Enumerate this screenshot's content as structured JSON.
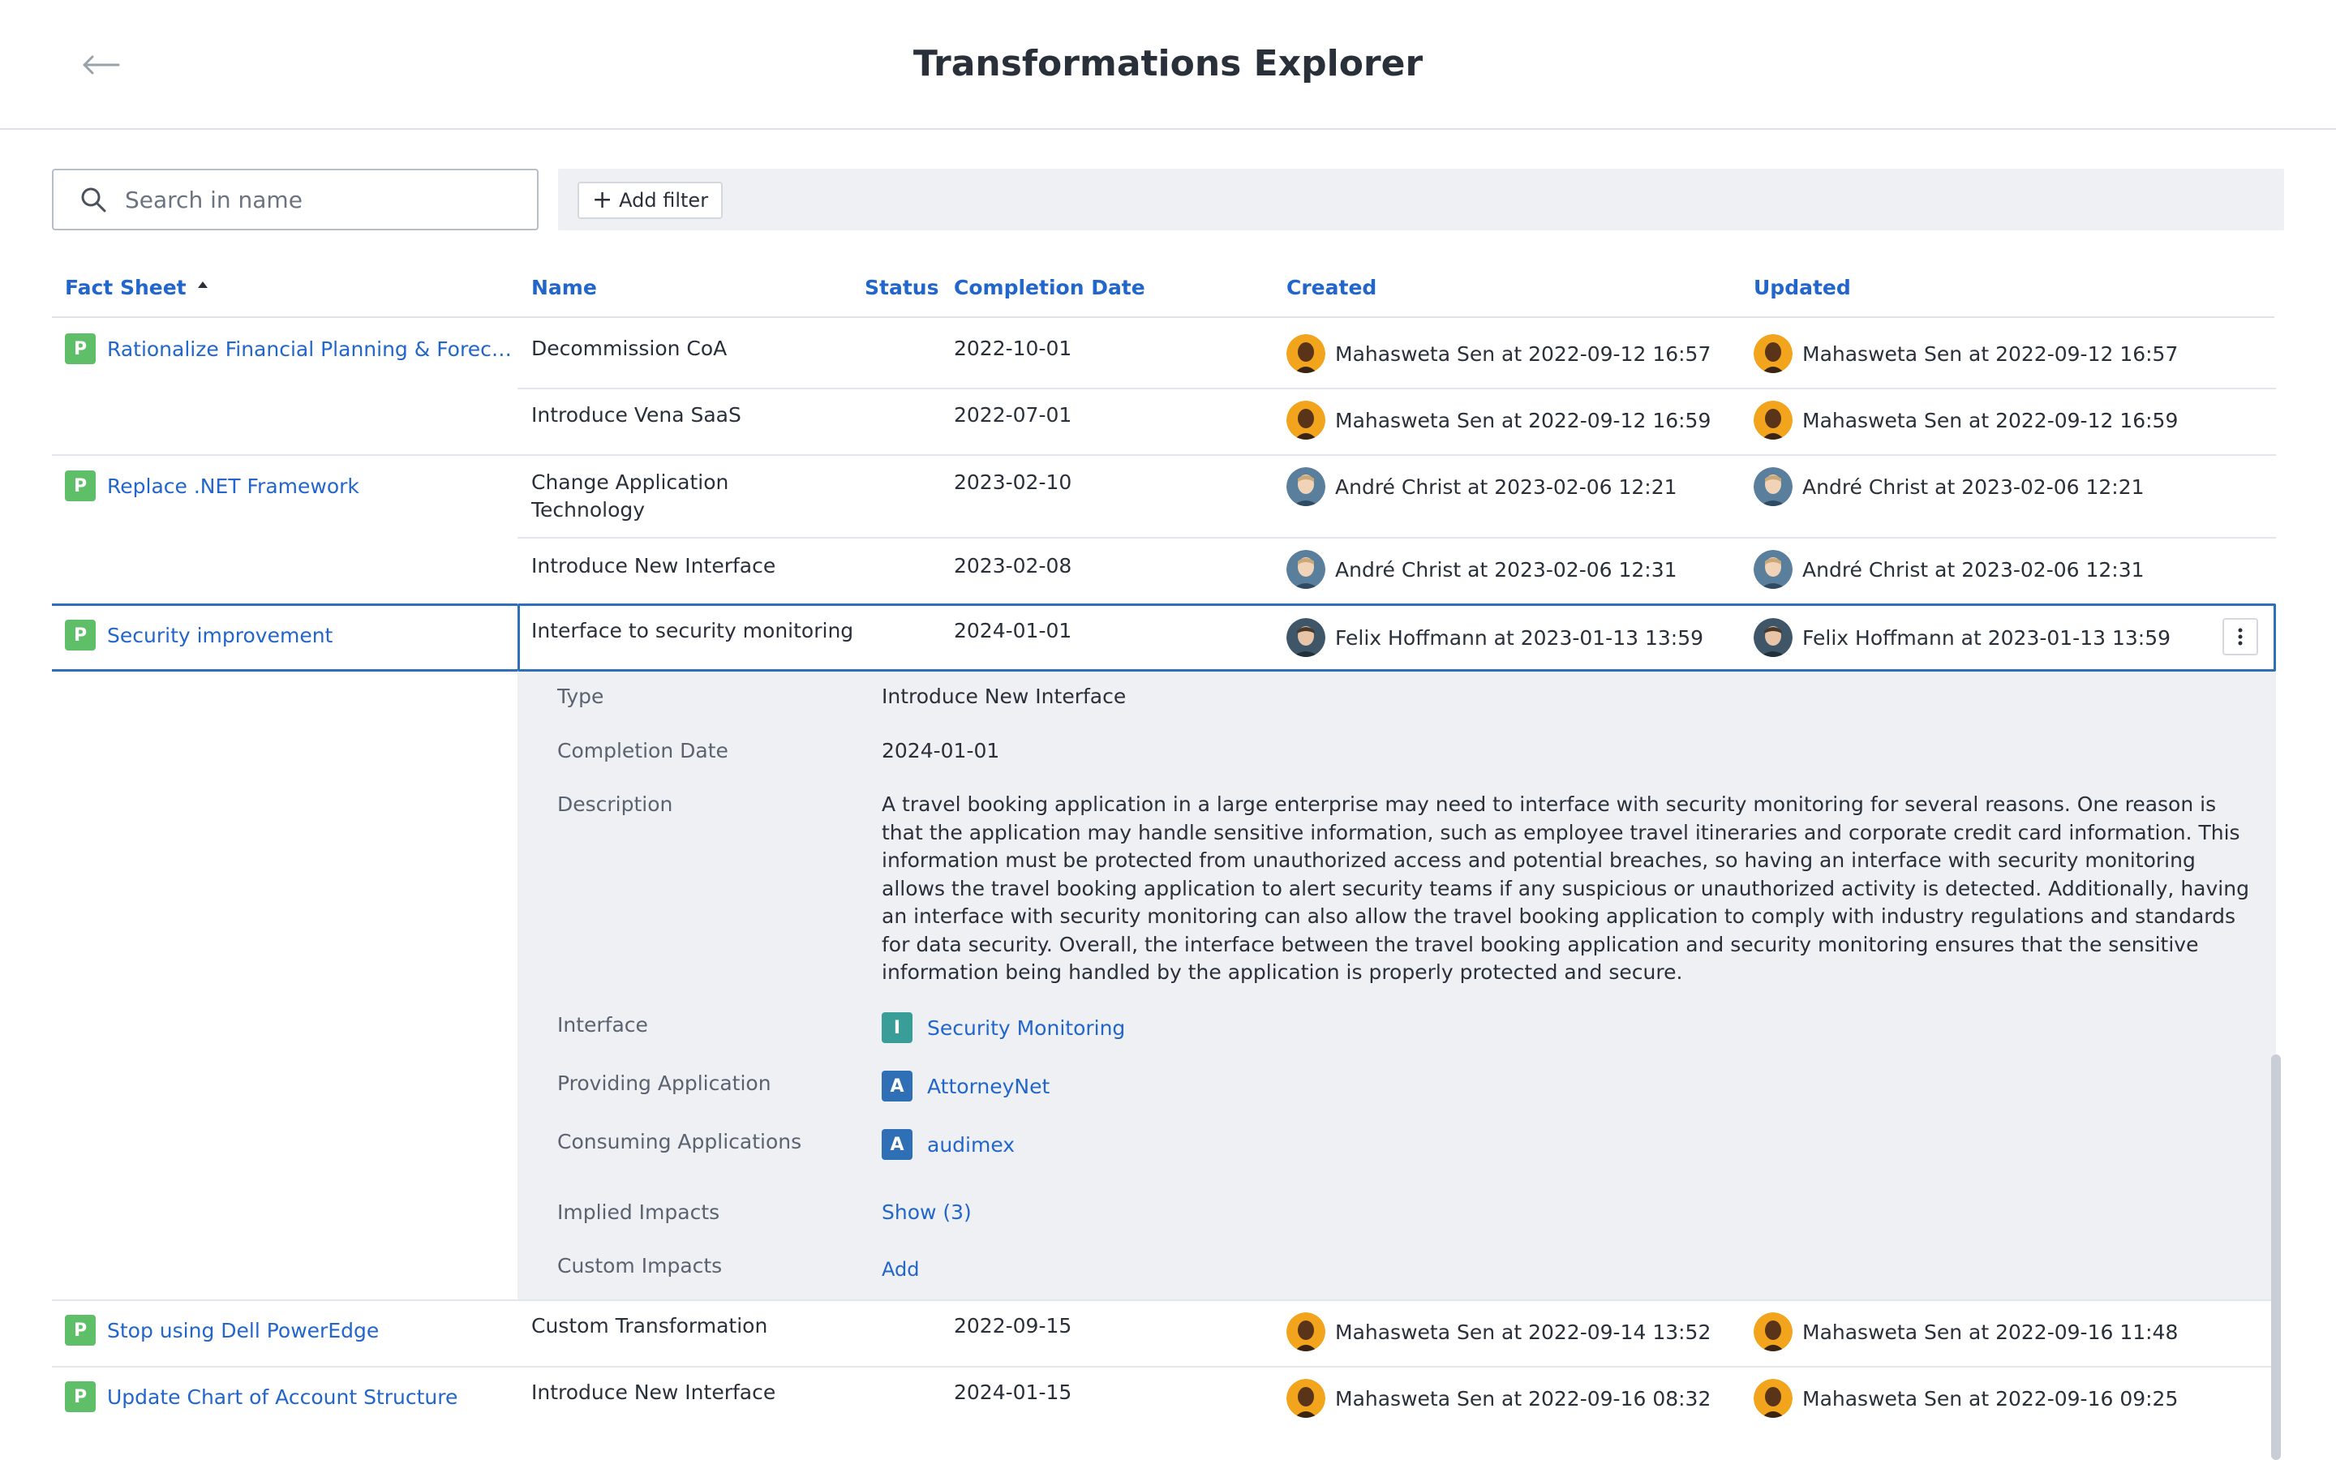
{
  "header": {
    "title": "Transformations Explorer"
  },
  "search": {
    "placeholder": "Search in name"
  },
  "filter": {
    "add_label": "Add filter"
  },
  "columns": {
    "fact_sheet": "Fact Sheet",
    "name": "Name",
    "status": "Status",
    "completion_date": "Completion Date",
    "created": "Created",
    "updated": "Updated"
  },
  "rows": [
    {
      "fact_sheet": "Rationalize Financial Planning & Forecas...",
      "badge": "P",
      "name": "Decommission CoA",
      "completion": "2022-10-01",
      "created": "Mahasweta Sen at 2022-09-12 16:57",
      "updated": "Mahasweta Sen at 2022-09-12 16:57"
    },
    {
      "fact_sheet": "",
      "name": "Introduce Vena SaaS",
      "completion": "2022-07-01",
      "created": "Mahasweta Sen at 2022-09-12 16:59",
      "updated": "Mahasweta Sen at 2022-09-12 16:59"
    },
    {
      "fact_sheet": "Replace .NET Framework",
      "badge": "P",
      "name": "Change Application Technology",
      "completion": "2023-02-10",
      "created": "André Christ at 2023-02-06 12:21",
      "updated": "André Christ at 2023-02-06 12:21"
    },
    {
      "fact_sheet": "",
      "name": "Introduce New Interface",
      "completion": "2023-02-08",
      "created": "André Christ at 2023-02-06 12:31",
      "updated": "André Christ at 2023-02-06 12:31"
    },
    {
      "fact_sheet": "Security improvement",
      "badge": "P",
      "name": "Interface to security monitoring",
      "completion": "2024-01-01",
      "created": "Felix Hoffmann at 2023-01-13 13:59",
      "updated": "Felix Hoffmann at 2023-01-13 13:59"
    },
    {
      "fact_sheet": "Stop using Dell PowerEdge",
      "badge": "P",
      "name": "Custom Transformation",
      "completion": "2022-09-15",
      "created": "Mahasweta Sen at 2022-09-14 13:52",
      "updated": "Mahasweta Sen at 2022-09-16 11:48"
    },
    {
      "fact_sheet": "Update Chart of Account Structure",
      "badge": "P",
      "name": "Introduce New Interface",
      "completion": "2024-01-15",
      "created": "Mahasweta Sen at 2022-09-16 08:32",
      "updated": "Mahasweta Sen at 2022-09-16 09:25"
    }
  ],
  "detail": {
    "type_label": "Type",
    "type_value": "Introduce New Interface",
    "completion_label": "Completion Date",
    "completion_value": "2024-01-01",
    "description_label": "Description",
    "description_value": "A travel booking application in a large enterprise may need to interface with security monitoring for several reasons. One reason is that the application may handle sensitive information, such as employee travel itineraries and corporate credit card information. This information must be protected from unauthorized access and potential breaches, so having an interface with security monitoring allows the travel booking application to alert security teams if any suspicious or unauthorized activity is detected. Additionally, having an interface with security monitoring can also allow the travel booking application to comply with industry regulations and standards for data security. Overall, the interface between the travel booking application and security monitoring ensures that the sensitive information being handled by the application is properly protected and secure.",
    "interface_label": "Interface",
    "interface_badge": "I",
    "interface_value": "Security Monitoring",
    "providing_label": "Providing Application",
    "providing_badge": "A",
    "providing_value": "AttorneyNet",
    "consuming_label": "Consuming Applications",
    "consuming_badge": "A",
    "consuming_value": "audimex",
    "implied_label": "Implied Impacts",
    "implied_value": "Show (3)",
    "custom_label": "Custom Impacts",
    "custom_value": "Add"
  },
  "colors": {
    "accent": "#2266cc",
    "selected_border": "#2f6fb5",
    "badge_project": "#5fbf68",
    "badge_interface": "#3a9e98",
    "badge_application": "#2f6fb5",
    "detail_bg": "#eef0f3"
  }
}
